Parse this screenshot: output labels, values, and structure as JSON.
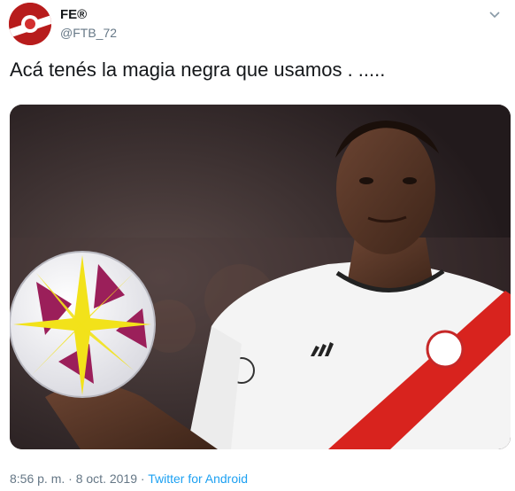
{
  "author": {
    "name": "FE®",
    "handle": "@FTB_72"
  },
  "tweet": {
    "text": "Acá tenés la magia negra que usamos . .....",
    "time": "8:56 p. m.",
    "separator": "·",
    "date": "8 oct. 2019",
    "source": "Twitter for Android"
  },
  "icons": {
    "menu": "chevron-down-icon"
  },
  "colors": {
    "link": "#1da1f2",
    "muted": "#657786",
    "jersey_stripe": "#d8231e"
  }
}
